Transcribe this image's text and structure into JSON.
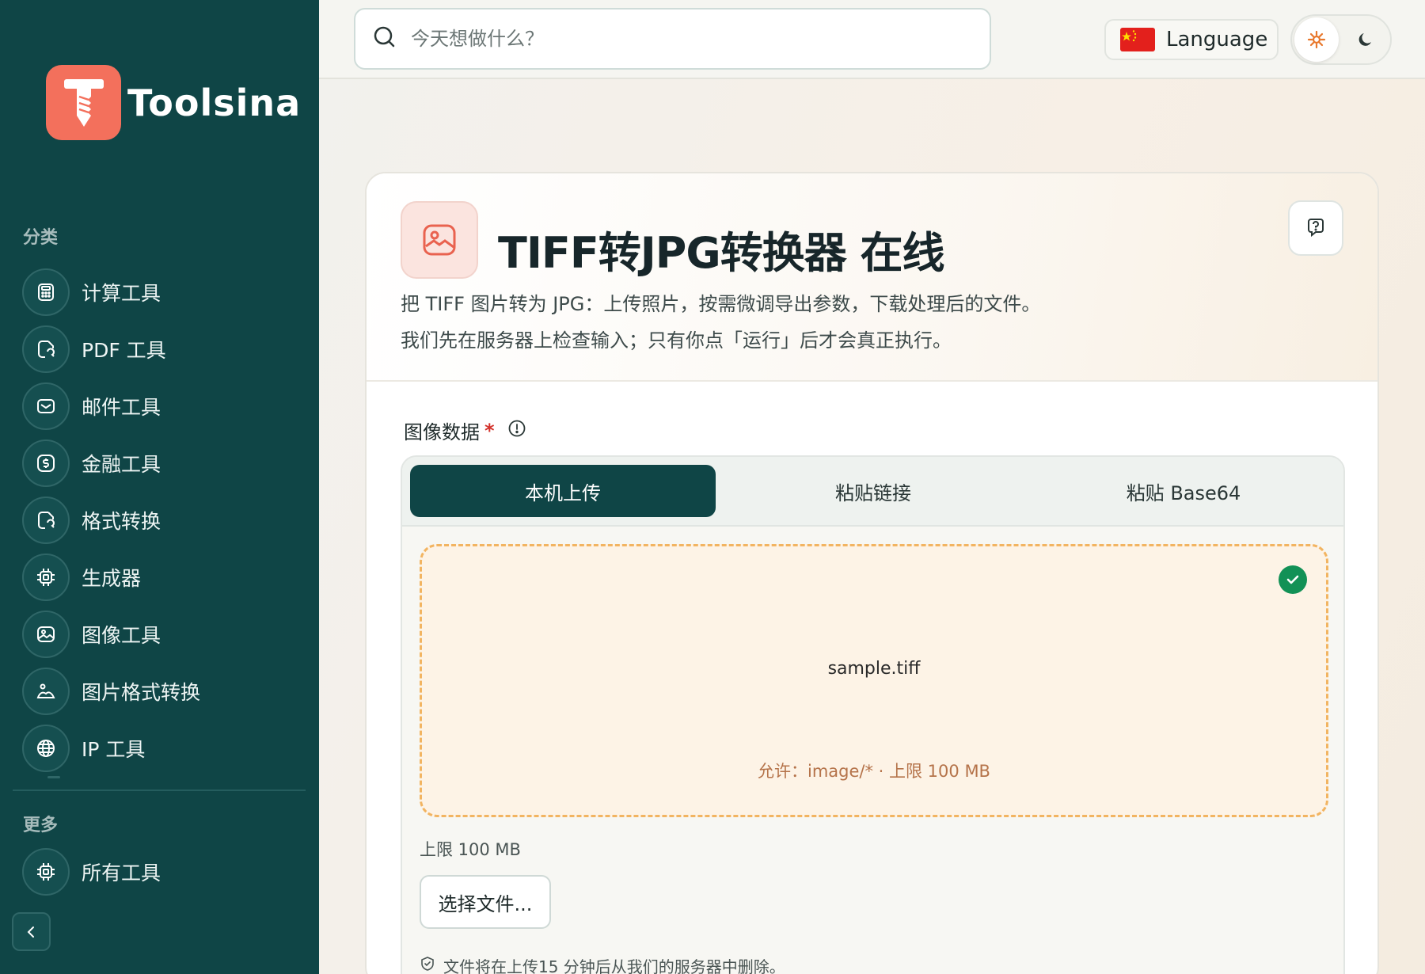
{
  "brand": {
    "name": "Toolsina"
  },
  "sidebar": {
    "categories_title": "分类",
    "items": [
      {
        "label": "计算工具",
        "icon": "calculator-icon"
      },
      {
        "label": "PDF 工具",
        "icon": "document-icon"
      },
      {
        "label": "邮件工具",
        "icon": "mail-icon"
      },
      {
        "label": "金融工具",
        "icon": "dollar-icon"
      },
      {
        "label": "格式转换",
        "icon": "convert-icon"
      },
      {
        "label": "生成器",
        "icon": "chip-icon"
      },
      {
        "label": "图像工具",
        "icon": "image-icon"
      },
      {
        "label": "图片格式转换",
        "icon": "image-convert-icon"
      },
      {
        "label": "IP 工具",
        "icon": "globe-icon"
      }
    ],
    "more_title": "更多",
    "more_items": [
      {
        "label": "所有工具",
        "icon": "chip-icon"
      }
    ]
  },
  "header": {
    "search_placeholder": "今天想做什么？",
    "language_label": "Language",
    "flag_icon": "china-flag-icon"
  },
  "tool": {
    "title": "TIFF转JPG转换器 在线",
    "desc_line1": "把 TIFF 图片转为 JPG：上传照片，按需微调导出参数，下载处理后的文件。",
    "desc_line2": "我们先在服务器上检查输入；只有你点「运行」后才会真正执行。"
  },
  "form": {
    "field_label": "图像数据",
    "required_mark": "*",
    "tabs": [
      "本机上传",
      "粘贴链接",
      "粘贴 Base64"
    ],
    "active_tab": "本机上传",
    "file_name": "sample.tiff",
    "allow_text": "允许：image/* · 上限 100 MB",
    "limit_text": "上限 100 MB",
    "choose_button": "选择文件...",
    "notice": "文件将在上传15 分钟后从我们的服务器中删除。"
  },
  "colors": {
    "sidebar_bg": "#0f4546",
    "accent_logo": "#f3705c",
    "active_tab": "#0f4546",
    "dropzone_border": "#f2b461",
    "success": "#129156"
  }
}
